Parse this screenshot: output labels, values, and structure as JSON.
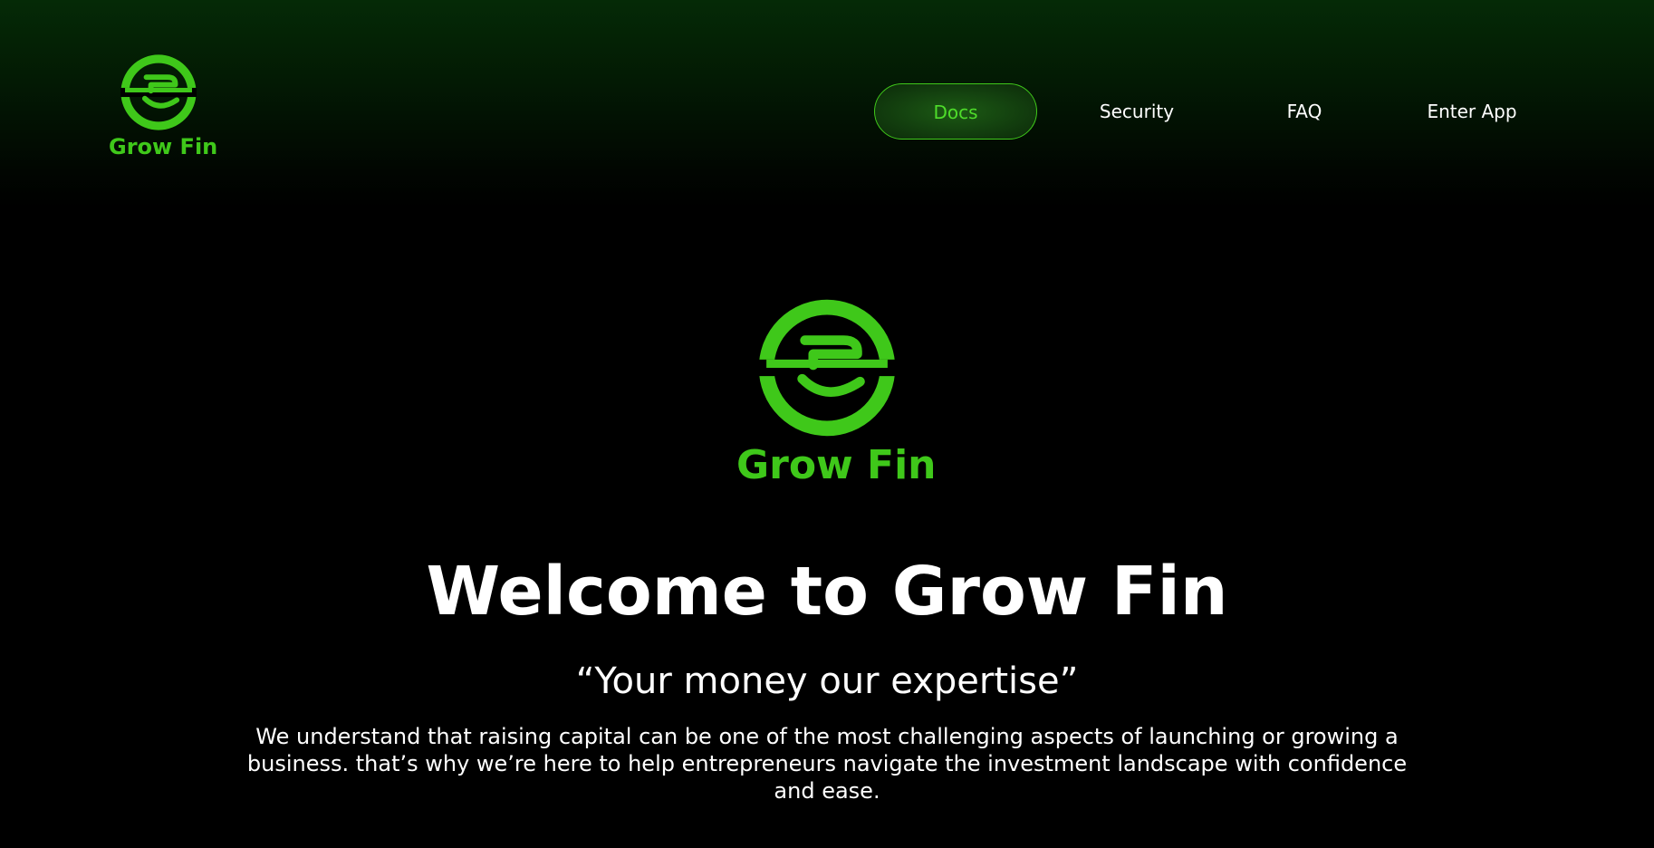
{
  "brand": {
    "name": "Grow Fin",
    "accent_color": "#3fc81a",
    "logo_icon": "grow-fin-logo-icon"
  },
  "nav": {
    "items": [
      {
        "label": "Docs",
        "active": true
      },
      {
        "label": "Security",
        "active": false
      },
      {
        "label": "FAQ",
        "active": false
      },
      {
        "label": "Enter App",
        "active": false
      }
    ]
  },
  "hero": {
    "brand_name": "Grow Fin",
    "title": "Welcome to Grow Fin",
    "tagline": "“Your money our expertise”",
    "description": "We understand that raising capital can be one of the most challenging aspects of launching or growing a business. that’s why we’re here to help entrepreneurs navigate the investment landscape with confidence and ease."
  }
}
